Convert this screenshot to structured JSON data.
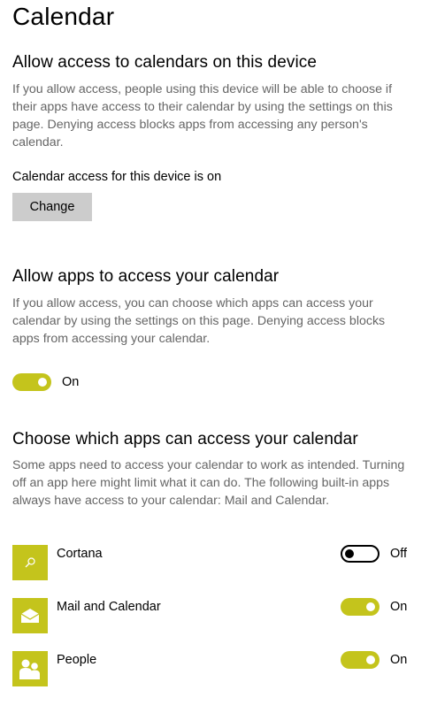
{
  "page": {
    "title": "Calendar"
  },
  "device_access": {
    "heading": "Allow access to calendars on this device",
    "description": "If you allow access, people using this device will be able to choose if their apps have access to their calendar by using the settings on this page. Denying access blocks apps from accessing any person's calendar.",
    "status": "Calendar access for this device is on",
    "change_label": "Change"
  },
  "app_access": {
    "heading": "Allow apps to access your calendar",
    "description": "If you allow access, you can choose which apps can access your calendar by using the settings on this page. Denying access blocks apps from accessing your calendar.",
    "toggle_state": "On"
  },
  "choose_apps": {
    "heading": "Choose which apps can access your calendar",
    "description": "Some apps need to access your calendar to work as intended. Turning off an app here might limit what it can do. The following built-in apps always have access to your calendar: Mail and Calendar.",
    "apps": [
      {
        "name": "Cortana",
        "icon": "search-icon",
        "state": "Off"
      },
      {
        "name": "Mail and Calendar",
        "icon": "envelope-icon",
        "state": "On"
      },
      {
        "name": "People",
        "icon": "people-icon",
        "state": "On"
      }
    ]
  },
  "colors": {
    "accent": "#c4c41c",
    "description_text": "#666666",
    "button_bg": "#cccccc"
  }
}
